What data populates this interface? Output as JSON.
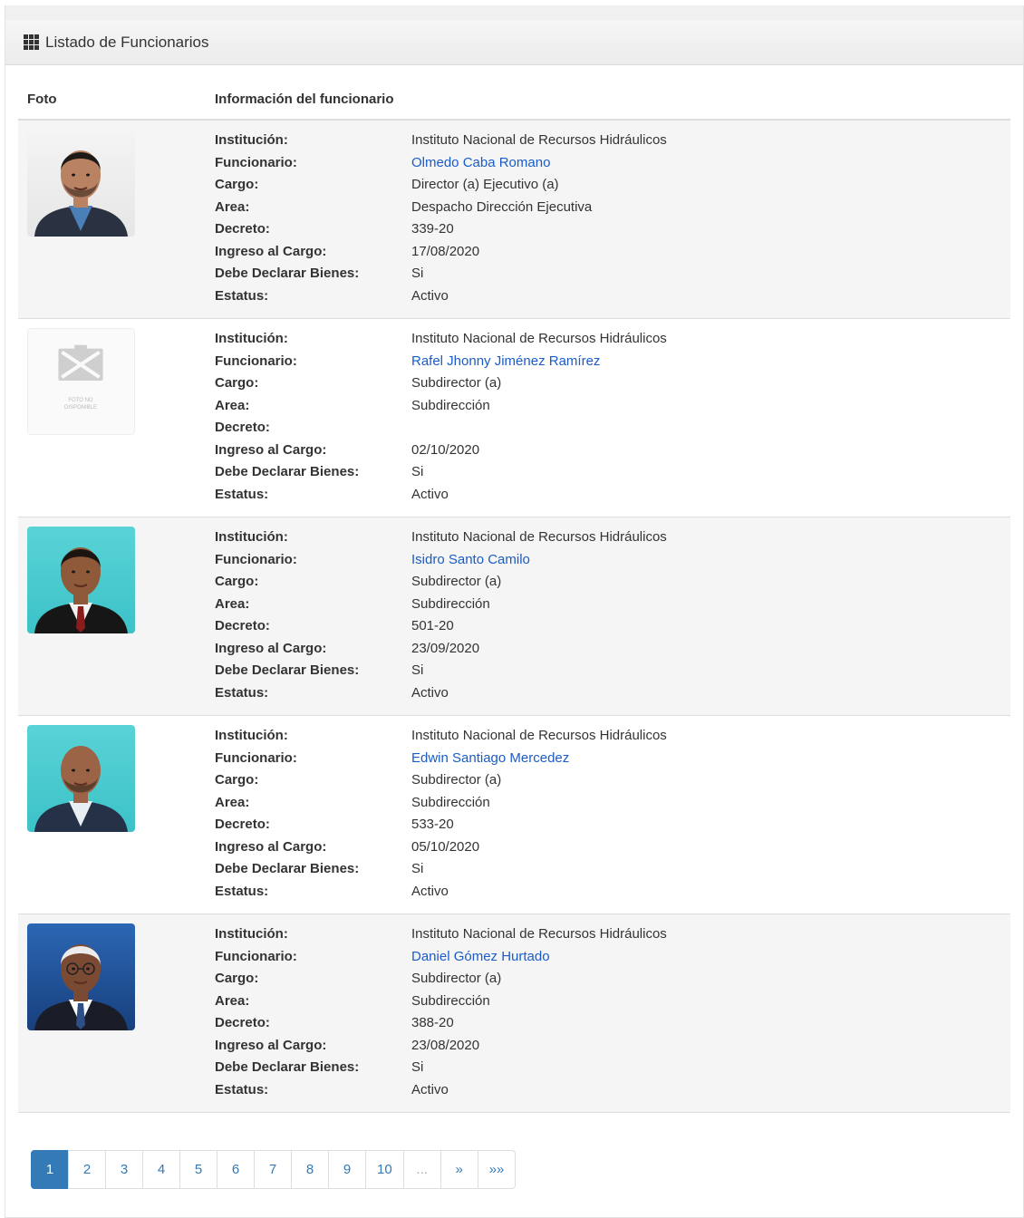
{
  "panel": {
    "title": "Listado de Funcionarios",
    "icon": "grid-icon"
  },
  "table": {
    "columns": [
      "Foto",
      "Información del funcionario"
    ],
    "labels": {
      "institucion": "Institución:",
      "funcionario": "Funcionario:",
      "cargo": "Cargo:",
      "area": "Area:",
      "decreto": "Decreto:",
      "ingreso": "Ingreso al Cargo:",
      "bienes": "Debe Declarar Bienes:",
      "estatus": "Estatus:"
    },
    "rows": [
      {
        "photo": "portrait-photo",
        "institucion": "Instituto Nacional de Recursos Hidráulicos",
        "funcionario": "Olmedo Caba Romano",
        "cargo": "Director (a) Ejecutivo (a)",
        "area": "Despacho Dirección Ejecutiva",
        "decreto": "339-20",
        "ingreso": "17/08/2020",
        "bienes": "Si",
        "estatus": "Activo"
      },
      {
        "photo": "no-photo-placeholder",
        "placeholder_text": "FOTO NO DISPONIBLE",
        "institucion": "Instituto Nacional de Recursos Hidráulicos",
        "funcionario": "Rafel Jhonny Jiménez Ramírez",
        "cargo": "Subdirector (a)",
        "area": "Subdirección",
        "decreto": "",
        "ingreso": "02/10/2020",
        "bienes": "Si",
        "estatus": "Activo"
      },
      {
        "photo": "portrait-photo",
        "institucion": "Instituto Nacional de Recursos Hidráulicos",
        "funcionario": "Isidro Santo Camilo",
        "cargo": "Subdirector (a)",
        "area": "Subdirección",
        "decreto": "501-20",
        "ingreso": "23/09/2020",
        "bienes": "Si",
        "estatus": "Activo"
      },
      {
        "photo": "portrait-photo",
        "institucion": "Instituto Nacional de Recursos Hidráulicos",
        "funcionario": "Edwin Santiago Mercedez",
        "cargo": "Subdirector (a)",
        "area": "Subdirección",
        "decreto": "533-20",
        "ingreso": "05/10/2020",
        "bienes": "Si",
        "estatus": "Activo"
      },
      {
        "photo": "portrait-photo",
        "institucion": "Instituto Nacional de Recursos Hidráulicos",
        "funcionario": "Daniel Gómez Hurtado",
        "cargo": "Subdirector (a)",
        "area": "Subdirección",
        "decreto": "388-20",
        "ingreso": "23/08/2020",
        "bienes": "Si",
        "estatus": "Activo"
      }
    ]
  },
  "pagination": {
    "pages": [
      "1",
      "2",
      "3",
      "4",
      "5",
      "6",
      "7",
      "8",
      "9",
      "10",
      "...",
      "»",
      "»»"
    ],
    "current": "1"
  },
  "colors": {
    "link": "#1a5cc8",
    "active_page": "#337ab7",
    "stripe": "#f5f5f5"
  }
}
